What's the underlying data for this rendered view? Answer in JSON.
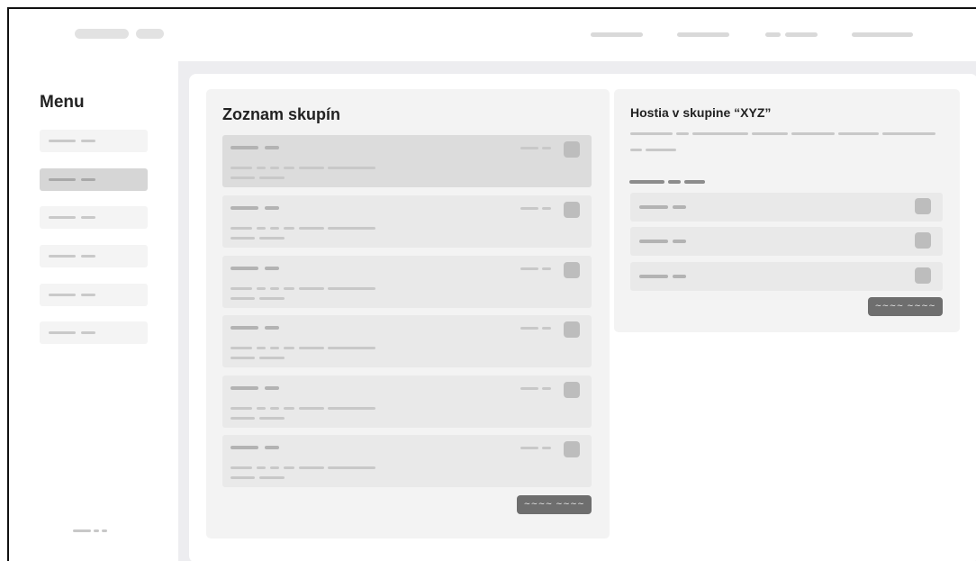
{
  "sidebar": {
    "title": "Menu",
    "items": [
      {
        "active": false
      },
      {
        "active": true
      },
      {
        "active": false
      },
      {
        "active": false
      },
      {
        "active": false
      },
      {
        "active": false
      }
    ]
  },
  "groups_panel": {
    "title": "Zoznam skupín",
    "groups": [
      {
        "selected": true
      },
      {
        "selected": false
      },
      {
        "selected": false
      },
      {
        "selected": false
      },
      {
        "selected": false
      },
      {
        "selected": false
      }
    ],
    "button_label": "~~~~ ~~~~"
  },
  "guests_panel": {
    "title": "Hostia v skupine “XYZ”",
    "guests": [
      {},
      {},
      {}
    ],
    "button_label": "~~~~ ~~~~"
  },
  "colors": {
    "button": "#6e6e6e",
    "background": "#ededf0",
    "panel": "#f3f3f3",
    "selected": "#dcdcdc"
  }
}
